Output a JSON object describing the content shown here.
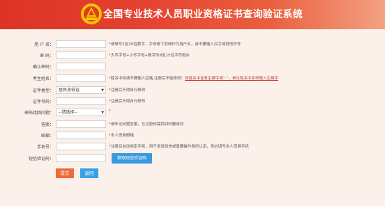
{
  "header": {
    "title": "全国专业技术人员职业资格证书查询验证系统",
    "logo_icon": "pta-logo"
  },
  "form": {
    "username": {
      "label": "用 户 名：",
      "value": "",
      "hint": "*请填写5至20位数字、字母或下划线作为用户名，请不要输入汉字或其他符号"
    },
    "password": {
      "label": "密 码：",
      "value": "",
      "hint": "*大写字母+小写字母+数字的8至15位字符组合"
    },
    "confirm_password": {
      "label": "确认密码：",
      "value": ""
    },
    "name": {
      "label": "考生姓名：",
      "value": "",
      "hint": "*姓名中间请不要输入空格,注册后不能修改！",
      "hint_link": "如姓名中含有生僻字或“·”，参见姓名中如何输入生僻字"
    },
    "id_type": {
      "label": "证件类型：",
      "selected": "居民身份证",
      "hint": "*注册后不得自行修改"
    },
    "id_number": {
      "label": "证件号码：",
      "value": "",
      "hint": "*注册后不得自行修改"
    },
    "security_question": {
      "label": "密码找回问题：",
      "selected": "--请选择--",
      "hint": "*"
    },
    "answer": {
      "label": "答案：",
      "value": "",
      "hint": "*请牢记问题答案，忘记密码需找回时要用到"
    },
    "email": {
      "label": "邮箱：",
      "value": "",
      "hint": "*本人现用邮箱"
    },
    "phone": {
      "label": "手机号：",
      "value": "",
      "hint": "*注册后自动绑定手机，用于发送短信或重要操作身份认定，务必填写本人现用手机"
    },
    "sms_code": {
      "label": "短信验证码：",
      "value": "",
      "button": "获取短信验证码"
    }
  },
  "actions": {
    "submit": "提交",
    "back": "返回"
  },
  "colors": {
    "header_start": "#dc3325",
    "header_end": "#f3a283",
    "panel_bg": "#fbf1ea",
    "submit": "#ee6b3a",
    "back": "#3aa0e6",
    "sms_button": "#3a9ae0"
  }
}
